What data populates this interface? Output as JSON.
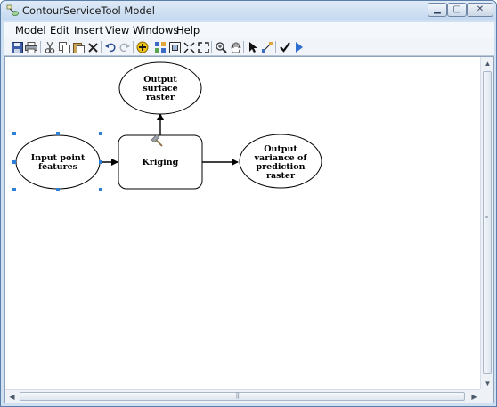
{
  "window": {
    "title": "ContourServiceTool Model",
    "min_label": "▁",
    "max_label": "▢",
    "close_label": "✕"
  },
  "menu": [
    {
      "label": "Model"
    },
    {
      "label": "Edit"
    },
    {
      "label": "Insert"
    },
    {
      "label": "View"
    },
    {
      "label": "Windows"
    },
    {
      "label": "Help"
    }
  ],
  "toolbar": {
    "icons": [
      "save-icon",
      "print-icon",
      "cut-icon",
      "copy-icon",
      "paste-icon",
      "delete-icon",
      "undo-icon",
      "redo-icon",
      "add-data-icon",
      "auto-layout-icon",
      "full-extent-icon",
      "fixed-zoom-in-icon",
      "fixed-zoom-out-icon",
      "zoom-in-icon",
      "pan-icon",
      "select-icon",
      "connect-icon",
      "validate-icon",
      "run-icon"
    ]
  },
  "model": {
    "nodes": {
      "input": {
        "lines": [
          "Input point",
          "features"
        ]
      },
      "tool": {
        "lines": [
          "Kriging"
        ]
      },
      "output_surface": {
        "lines": [
          "Output",
          "surface",
          "raster"
        ]
      },
      "output_variance": {
        "lines": [
          "Output",
          "variance of",
          "prediction",
          "raster"
        ]
      }
    }
  },
  "scroll": {
    "vgrip": "≡",
    "hgrip": "|||"
  }
}
